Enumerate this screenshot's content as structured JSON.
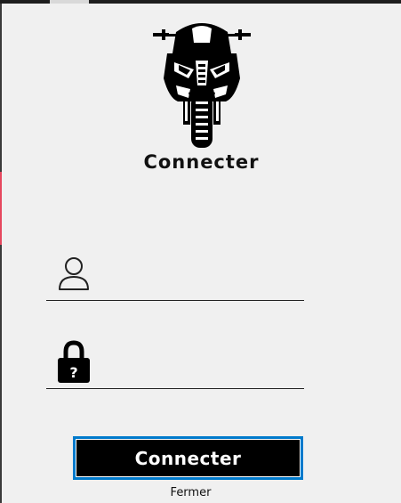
{
  "window": {
    "title": "Connecter"
  },
  "form": {
    "username": {
      "value": "",
      "placeholder": ""
    },
    "password": {
      "value": "",
      "placeholder": ""
    }
  },
  "buttons": {
    "connect_label": "Connecter",
    "close_label": "Fermer"
  },
  "icons": {
    "logo": "motorcycle-logo-icon",
    "user": "user-icon",
    "password": "lock-icon"
  },
  "colors": {
    "button_bg": "#000000",
    "button_focus": "#007acc",
    "window_bg": "#f0f0f0",
    "accent": "#e6475e"
  }
}
